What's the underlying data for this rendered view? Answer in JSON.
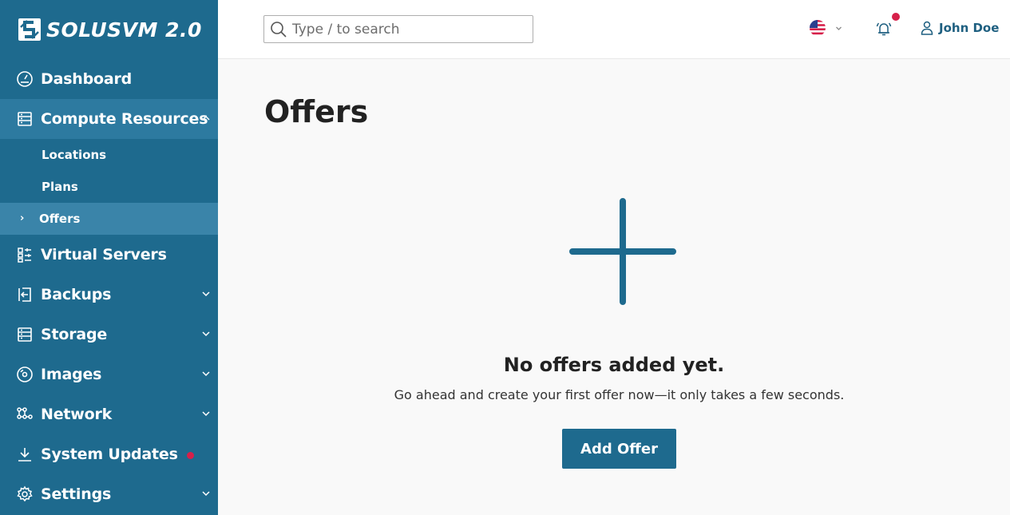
{
  "app": {
    "logo_text": "SOLUSVM 2.0",
    "brand_color": "#1e6a8e",
    "alert_color": "#d6204a"
  },
  "sidebar": {
    "items": [
      {
        "label": "Dashboard",
        "icon": "dashboard-gauge-icon"
      },
      {
        "label": "Compute Resources",
        "icon": "compute-resources-icon",
        "expanded": true,
        "children": [
          {
            "label": "Locations"
          },
          {
            "label": "Plans"
          },
          {
            "label": "Offers",
            "active": true
          }
        ]
      },
      {
        "label": "Virtual Servers",
        "icon": "virtual-servers-icon"
      },
      {
        "label": "Backups",
        "icon": "backups-icon"
      },
      {
        "label": "Storage",
        "icon": "storage-icon"
      },
      {
        "label": "Images",
        "icon": "images-disc-icon"
      },
      {
        "label": "Network",
        "icon": "network-icon"
      },
      {
        "label": "System Updates",
        "icon": "download-icon",
        "has_alert_dot": true
      },
      {
        "label": "Settings",
        "icon": "gear-icon"
      }
    ]
  },
  "header": {
    "search_placeholder": "Type / to search",
    "language_icon": "us-flag-icon",
    "notifications_icon": "bell-icon",
    "user_name": "John Doe"
  },
  "main": {
    "title": "Offers",
    "empty_state": {
      "icon": "plus-icon",
      "title": "No offers added yet.",
      "description": "Go ahead and create your first offer now—it only takes a few seconds.",
      "button_label": "Add Offer"
    }
  }
}
